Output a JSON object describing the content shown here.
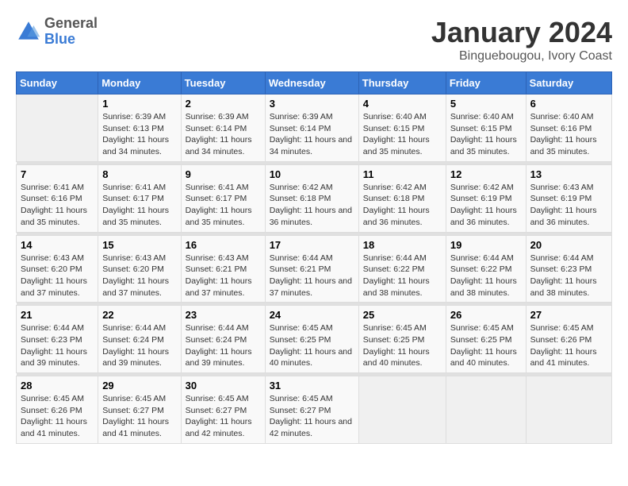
{
  "logo": {
    "general": "General",
    "blue": "Blue"
  },
  "title": "January 2024",
  "subtitle": "Binguebougou, Ivory Coast",
  "days_of_week": [
    "Sunday",
    "Monday",
    "Tuesday",
    "Wednesday",
    "Thursday",
    "Friday",
    "Saturday"
  ],
  "weeks": [
    [
      {
        "day": "",
        "info": ""
      },
      {
        "day": "1",
        "sunrise": "Sunrise: 6:39 AM",
        "sunset": "Sunset: 6:13 PM",
        "daylight": "Daylight: 11 hours and 34 minutes."
      },
      {
        "day": "2",
        "sunrise": "Sunrise: 6:39 AM",
        "sunset": "Sunset: 6:14 PM",
        "daylight": "Daylight: 11 hours and 34 minutes."
      },
      {
        "day": "3",
        "sunrise": "Sunrise: 6:39 AM",
        "sunset": "Sunset: 6:14 PM",
        "daylight": "Daylight: 11 hours and 34 minutes."
      },
      {
        "day": "4",
        "sunrise": "Sunrise: 6:40 AM",
        "sunset": "Sunset: 6:15 PM",
        "daylight": "Daylight: 11 hours and 35 minutes."
      },
      {
        "day": "5",
        "sunrise": "Sunrise: 6:40 AM",
        "sunset": "Sunset: 6:15 PM",
        "daylight": "Daylight: 11 hours and 35 minutes."
      },
      {
        "day": "6",
        "sunrise": "Sunrise: 6:40 AM",
        "sunset": "Sunset: 6:16 PM",
        "daylight": "Daylight: 11 hours and 35 minutes."
      }
    ],
    [
      {
        "day": "7",
        "sunrise": "Sunrise: 6:41 AM",
        "sunset": "Sunset: 6:16 PM",
        "daylight": "Daylight: 11 hours and 35 minutes."
      },
      {
        "day": "8",
        "sunrise": "Sunrise: 6:41 AM",
        "sunset": "Sunset: 6:17 PM",
        "daylight": "Daylight: 11 hours and 35 minutes."
      },
      {
        "day": "9",
        "sunrise": "Sunrise: 6:41 AM",
        "sunset": "Sunset: 6:17 PM",
        "daylight": "Daylight: 11 hours and 35 minutes."
      },
      {
        "day": "10",
        "sunrise": "Sunrise: 6:42 AM",
        "sunset": "Sunset: 6:18 PM",
        "daylight": "Daylight: 11 hours and 36 minutes."
      },
      {
        "day": "11",
        "sunrise": "Sunrise: 6:42 AM",
        "sunset": "Sunset: 6:18 PM",
        "daylight": "Daylight: 11 hours and 36 minutes."
      },
      {
        "day": "12",
        "sunrise": "Sunrise: 6:42 AM",
        "sunset": "Sunset: 6:19 PM",
        "daylight": "Daylight: 11 hours and 36 minutes."
      },
      {
        "day": "13",
        "sunrise": "Sunrise: 6:43 AM",
        "sunset": "Sunset: 6:19 PM",
        "daylight": "Daylight: 11 hours and 36 minutes."
      }
    ],
    [
      {
        "day": "14",
        "sunrise": "Sunrise: 6:43 AM",
        "sunset": "Sunset: 6:20 PM",
        "daylight": "Daylight: 11 hours and 37 minutes."
      },
      {
        "day": "15",
        "sunrise": "Sunrise: 6:43 AM",
        "sunset": "Sunset: 6:20 PM",
        "daylight": "Daylight: 11 hours and 37 minutes."
      },
      {
        "day": "16",
        "sunrise": "Sunrise: 6:43 AM",
        "sunset": "Sunset: 6:21 PM",
        "daylight": "Daylight: 11 hours and 37 minutes."
      },
      {
        "day": "17",
        "sunrise": "Sunrise: 6:44 AM",
        "sunset": "Sunset: 6:21 PM",
        "daylight": "Daylight: 11 hours and 37 minutes."
      },
      {
        "day": "18",
        "sunrise": "Sunrise: 6:44 AM",
        "sunset": "Sunset: 6:22 PM",
        "daylight": "Daylight: 11 hours and 38 minutes."
      },
      {
        "day": "19",
        "sunrise": "Sunrise: 6:44 AM",
        "sunset": "Sunset: 6:22 PM",
        "daylight": "Daylight: 11 hours and 38 minutes."
      },
      {
        "day": "20",
        "sunrise": "Sunrise: 6:44 AM",
        "sunset": "Sunset: 6:23 PM",
        "daylight": "Daylight: 11 hours and 38 minutes."
      }
    ],
    [
      {
        "day": "21",
        "sunrise": "Sunrise: 6:44 AM",
        "sunset": "Sunset: 6:23 PM",
        "daylight": "Daylight: 11 hours and 39 minutes."
      },
      {
        "day": "22",
        "sunrise": "Sunrise: 6:44 AM",
        "sunset": "Sunset: 6:24 PM",
        "daylight": "Daylight: 11 hours and 39 minutes."
      },
      {
        "day": "23",
        "sunrise": "Sunrise: 6:44 AM",
        "sunset": "Sunset: 6:24 PM",
        "daylight": "Daylight: 11 hours and 39 minutes."
      },
      {
        "day": "24",
        "sunrise": "Sunrise: 6:45 AM",
        "sunset": "Sunset: 6:25 PM",
        "daylight": "Daylight: 11 hours and 40 minutes."
      },
      {
        "day": "25",
        "sunrise": "Sunrise: 6:45 AM",
        "sunset": "Sunset: 6:25 PM",
        "daylight": "Daylight: 11 hours and 40 minutes."
      },
      {
        "day": "26",
        "sunrise": "Sunrise: 6:45 AM",
        "sunset": "Sunset: 6:25 PM",
        "daylight": "Daylight: 11 hours and 40 minutes."
      },
      {
        "day": "27",
        "sunrise": "Sunrise: 6:45 AM",
        "sunset": "Sunset: 6:26 PM",
        "daylight": "Daylight: 11 hours and 41 minutes."
      }
    ],
    [
      {
        "day": "28",
        "sunrise": "Sunrise: 6:45 AM",
        "sunset": "Sunset: 6:26 PM",
        "daylight": "Daylight: 11 hours and 41 minutes."
      },
      {
        "day": "29",
        "sunrise": "Sunrise: 6:45 AM",
        "sunset": "Sunset: 6:27 PM",
        "daylight": "Daylight: 11 hours and 41 minutes."
      },
      {
        "day": "30",
        "sunrise": "Sunrise: 6:45 AM",
        "sunset": "Sunset: 6:27 PM",
        "daylight": "Daylight: 11 hours and 42 minutes."
      },
      {
        "day": "31",
        "sunrise": "Sunrise: 6:45 AM",
        "sunset": "Sunset: 6:27 PM",
        "daylight": "Daylight: 11 hours and 42 minutes."
      },
      {
        "day": "",
        "info": ""
      },
      {
        "day": "",
        "info": ""
      },
      {
        "day": "",
        "info": ""
      }
    ]
  ]
}
